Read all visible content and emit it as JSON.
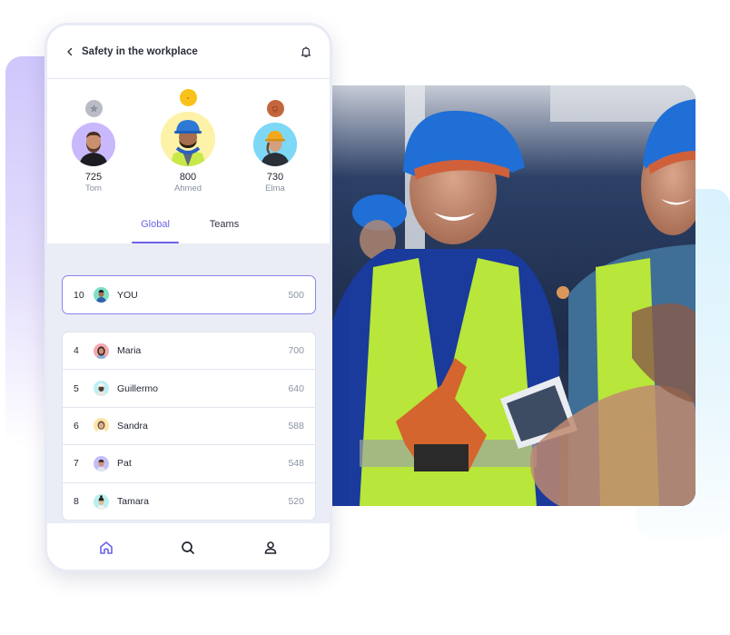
{
  "header": {
    "title": "Safety in the workplace",
    "back_icon": "chevron-left-icon",
    "notification_icon": "bell-icon"
  },
  "podium": [
    {
      "place": 2,
      "medal": "silver",
      "medal_color": "#b9bcc4",
      "avatar_bg": "#c9b8fb",
      "score": "725",
      "name": "Tom"
    },
    {
      "place": 1,
      "medal": "gold",
      "medal_color": "#f8c21a",
      "avatar_bg": "#fdf2a8",
      "score": "800",
      "name": "Ahmed"
    },
    {
      "place": 3,
      "medal": "bronze",
      "medal_color": "#c4663d",
      "avatar_bg": "#7dd8f6",
      "score": "730",
      "name": "Elma"
    }
  ],
  "tabs": [
    {
      "label": "Global",
      "active": true
    },
    {
      "label": "Teams",
      "active": false
    }
  ],
  "current_user": {
    "rank": "10",
    "name": "YOU",
    "points": "500",
    "avatar_bg": "#7ee0c6"
  },
  "leaderboard": [
    {
      "rank": "4",
      "name": "Maria",
      "points": "700",
      "avatar_bg": "#f5a8b0"
    },
    {
      "rank": "5",
      "name": "Guillermo",
      "points": "640",
      "avatar_bg": "#bdeff5"
    },
    {
      "rank": "6",
      "name": "Sandra",
      "points": "588",
      "avatar_bg": "#fbe7a8"
    },
    {
      "rank": "7",
      "name": "Pat",
      "points": "548",
      "avatar_bg": "#c6bdf8"
    },
    {
      "rank": "8",
      "name": "Tamara",
      "points": "520",
      "avatar_bg": "#b8f0ee"
    }
  ],
  "bottom_nav": [
    {
      "icon": "home-icon",
      "active": true
    },
    {
      "icon": "search-icon",
      "active": false
    },
    {
      "icon": "profile-icon",
      "active": false
    }
  ],
  "colors": {
    "accent": "#6b63e6",
    "list_background": "#eaedf6",
    "points_text": "#8a92a2"
  },
  "photo": {
    "subject": "workers-in-hard-hats-photo"
  }
}
